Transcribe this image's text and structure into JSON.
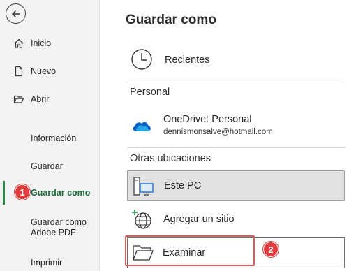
{
  "sidebar": {
    "items": [
      {
        "label": "Inicio",
        "icon": "home-icon"
      },
      {
        "label": "Nuevo",
        "icon": "new-document-icon"
      },
      {
        "label": "Abrir",
        "icon": "folder-open-icon"
      },
      {
        "label": "Información"
      },
      {
        "label": "Guardar"
      },
      {
        "label": "Guardar como"
      },
      {
        "label": "Guardar como Adobe PDF"
      },
      {
        "label": "Imprimir"
      }
    ],
    "active": "Guardar como",
    "back_icon": "back-arrow-icon"
  },
  "annotations": {
    "step1": "1",
    "step2": "2",
    "color": "#e23b3b"
  },
  "main": {
    "title": "Guardar como",
    "recent": {
      "label": "Recientes",
      "icon": "clock-icon"
    },
    "personal_section": "Personal",
    "onedrive": {
      "label": "OneDrive: Personal",
      "email": "dennismonsalve@hotmail.com",
      "icon": "onedrive-cloud-icon"
    },
    "other_section": "Otras ubicaciones",
    "this_pc": {
      "label": "Este PC",
      "icon": "computer-icon"
    },
    "add_site": {
      "label": "Agregar un sitio",
      "icon": "globe-add-icon"
    },
    "browse": {
      "label": "Examinar",
      "icon": "folder-icon"
    }
  },
  "colors": {
    "accent_green": "#1e6b3a",
    "onedrive_blue": "#0a64c8"
  }
}
